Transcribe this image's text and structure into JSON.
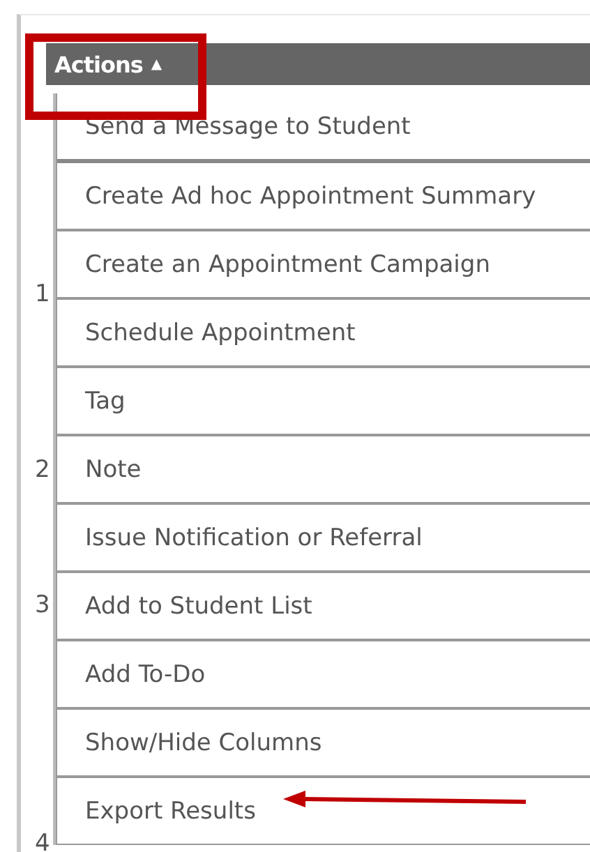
{
  "header": {
    "label": "Actions",
    "caret": "▲"
  },
  "row_numbers": [
    {
      "label": "1"
    },
    {
      "label": "2"
    },
    {
      "label": "3"
    },
    {
      "label": "4"
    }
  ],
  "menu": [
    {
      "label": "Send a Message to Student",
      "arrow": false
    },
    {
      "label": "Create Ad hoc Appointment Summary",
      "arrow": false
    },
    {
      "label": "Create an Appointment Campaign",
      "arrow": false
    },
    {
      "label": "Schedule Appointment",
      "arrow": false
    },
    {
      "label": "Tag",
      "arrow": false
    },
    {
      "label": "Note",
      "arrow": false
    },
    {
      "label": "Issue Notification or Referral",
      "arrow": false
    },
    {
      "label": "Add to Student List",
      "arrow": false
    },
    {
      "label": "Add To-Do",
      "arrow": false
    },
    {
      "label": "Show/Hide Columns",
      "arrow": false
    },
    {
      "label": "Export Results",
      "arrow": true
    }
  ],
  "annotations": {
    "highlight_box": true
  }
}
